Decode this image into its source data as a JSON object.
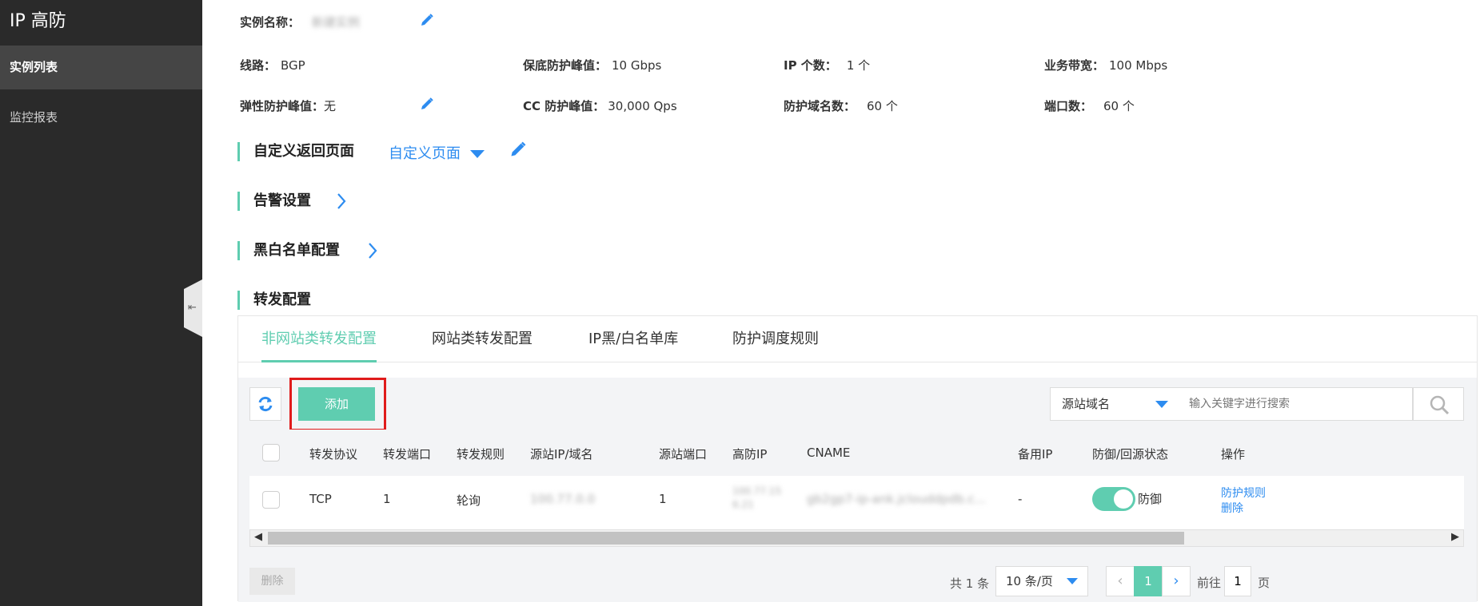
{
  "sidebar": {
    "title": "IP 高防",
    "items": [
      {
        "label": "实例列表",
        "active": true
      },
      {
        "label": "监控报表",
        "active": false
      }
    ]
  },
  "info": {
    "instance_name_label": "实例名称：",
    "instance_name_value": "新建实例",
    "line_label": "线路：",
    "line_value": "BGP",
    "base_peak_label": "保底防护峰值：",
    "base_peak_value": "10 Gbps",
    "ip_count_label": "IP 个数：",
    "ip_count_value": "1 个",
    "bandwidth_label": "业务带宽：",
    "bandwidth_value": "100 Mbps",
    "elastic_peak_label": "弹性防护峰值：",
    "elastic_peak_value": "无",
    "cc_peak_label": "CC 防护峰值：",
    "cc_peak_value": "30,000 Qps",
    "domain_count_label": "防护域名数：",
    "domain_count_value": "60 个",
    "port_count_label": "端口数：",
    "port_count_value": "60 个"
  },
  "sections": {
    "custom_page_title": "自定义返回页面",
    "custom_page_select": "自定义页面",
    "alarm_title": "告警设置",
    "blacklist_title": "黑白名单配置",
    "forward_title": "转发配置"
  },
  "tabs": [
    {
      "label": "非网站类转发配置",
      "active": true
    },
    {
      "label": "网站类转发配置",
      "active": false
    },
    {
      "label": "IP黑/白名单库",
      "active": false
    },
    {
      "label": "防护调度规则",
      "active": false
    }
  ],
  "toolbar": {
    "add_label": "添加",
    "search_field": "源站域名",
    "search_placeholder": "输入关键字进行搜索"
  },
  "table": {
    "headers": [
      "转发协议",
      "转发端口",
      "转发规则",
      "源站IP/域名",
      "源站端口",
      "高防IP",
      "CNAME",
      "备用IP",
      "防御/回源状态",
      "操作"
    ],
    "row": {
      "protocol": "TCP",
      "port": "1",
      "rule": "轮询",
      "source_ip": "100.77.0.0",
      "source_port": "1",
      "ddos_ip_line1": "100.77.15",
      "ddos_ip_line2": "6.21",
      "cname": "gb2gp7-ip-ank.jclouddpdb.c...",
      "backup_ip": "-",
      "state_label": "防御",
      "state_on": true,
      "action_1": "防护规则",
      "action_2": "删除"
    }
  },
  "footer": {
    "delete_label": "删除",
    "total": "共 1 条",
    "page_size": "10 条/页",
    "current_page": "1",
    "goto_prefix": "前往",
    "goto_value": "1",
    "goto_suffix": "页"
  },
  "colors": {
    "accent": "#5fcdb0",
    "link": "#2d8cf0",
    "sidebar_bg": "#2a2a2a",
    "highlight": "#e01b1b"
  }
}
